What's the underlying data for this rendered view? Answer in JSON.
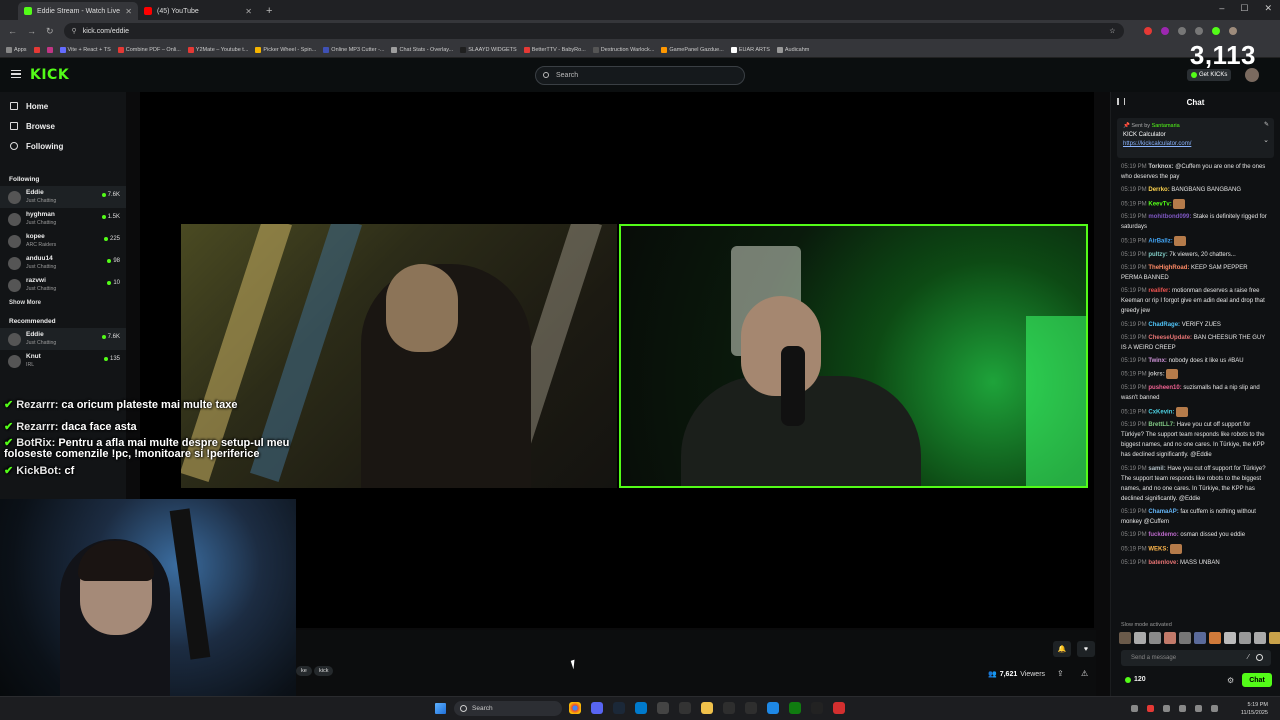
{
  "browser": {
    "tabs": [
      {
        "title": "Eddie Stream - Watch Live",
        "favicon_color": "#53fc18",
        "active": true
      },
      {
        "title": "(45) YouTube",
        "favicon_color": "#ff0000",
        "active": false
      }
    ],
    "new_tab": "+",
    "url": "kick.com/eddie",
    "window_controls": [
      "–",
      "☐",
      "✕"
    ],
    "bookmarks": [
      {
        "label": "Apps",
        "color": "#888888"
      },
      {
        "label": "",
        "color": "#e53935"
      },
      {
        "label": "",
        "color": "#c13584"
      },
      {
        "label": "Vite + React + TS",
        "color": "#646cff"
      },
      {
        "label": "Combine PDF – Onli...",
        "color": "#e53935"
      },
      {
        "label": "Y2Mate – Youtube t...",
        "color": "#e53935"
      },
      {
        "label": "Picker Wheel - Spin...",
        "color": "#f5b400"
      },
      {
        "label": "Online MP3 Cutter -...",
        "color": "#3f51b5"
      },
      {
        "label": "Chat Stats - Overlay...",
        "color": "#9e9e9e"
      },
      {
        "label": "SLAAYD WIDGETS",
        "color": "#1f1f1f"
      },
      {
        "label": "BetterTTV - BabyRo...",
        "color": "#e53935"
      },
      {
        "label": "Destruction Warlock...",
        "color": "#555555"
      },
      {
        "label": "GamePanel Gazdue...",
        "color": "#ff9800"
      },
      {
        "label": "EUAR ARTS",
        "color": "#ffffff"
      },
      {
        "label": "Audicahm",
        "color": "#999999"
      }
    ]
  },
  "kick": {
    "logo": "KICK",
    "search_placeholder": "Search",
    "get_kicks": "Get KICKs",
    "stream_overlay_viewers": "3,113",
    "accent": "#53fc18"
  },
  "sidebar": {
    "nav": [
      {
        "label": "Home",
        "icon": "home-icon"
      },
      {
        "label": "Browse",
        "icon": "browse-icon"
      },
      {
        "label": "Following",
        "icon": "heart-icon"
      }
    ],
    "following_title": "Following",
    "following": [
      {
        "name": "Eddie",
        "category": "Just Chatting",
        "viewers": "7.6K",
        "active": true
      },
      {
        "name": "hyghman",
        "category": "Just Chatting",
        "viewers": "1.5K"
      },
      {
        "name": "kopee",
        "category": "ARC Raiders",
        "viewers": "225"
      },
      {
        "name": "anduu14",
        "category": "Just Chatting",
        "viewers": "98"
      },
      {
        "name": "razvwi",
        "category": "Just Chatting",
        "viewers": "10"
      }
    ],
    "show_more": "Show More",
    "recommended_title": "Recommended",
    "recommended": [
      {
        "name": "Eddie",
        "category": "Just Chatting",
        "viewers": "7.6K",
        "active": true
      },
      {
        "name": "Knut",
        "category": "IRL",
        "viewers": "135"
      }
    ]
  },
  "overlay_chat": [
    {
      "user": "Rezarrr:",
      "text": "ca oricum plateste mai multe taxe"
    },
    {
      "user": "Rezarrr:",
      "text": "daca face asta"
    },
    {
      "user": "BotRix:",
      "text": "Pentru a afla mai multe despre setup-ul meu"
    },
    {
      "user": "",
      "text": "foloseste comenzile !pc, !monitoare si !periferice"
    },
    {
      "user": "KickBot:",
      "text": "cf"
    }
  ],
  "player": {
    "tags": [
      "ke",
      "kick"
    ],
    "viewers": "7,621",
    "viewers_label": "Viewers"
  },
  "chat": {
    "title": "Chat",
    "pinned": {
      "sent_by_prefix": "Sent by",
      "sent_by_user": "Santamaria",
      "title": "KICK Calculator",
      "link": "https://kickcalculator.com/"
    },
    "messages": [
      {
        "time": "05:19 PM",
        "user": "Torknox:",
        "color": "#cccccc",
        "text": "@Cuffem you are one of the ones who deserves the pay"
      },
      {
        "time": "05:19 PM",
        "user": "Derrko:",
        "color": "#ffd54f",
        "text": "BANGBANG BANGBANG"
      },
      {
        "time": "05:19 PM",
        "user": "KeevTv:",
        "color": "#53fc18",
        "text": ""
      },
      {
        "time": "05:19 PM",
        "user": "mohitbond099:",
        "color": "#7e57c2",
        "text": "Stake is definitely rigged for saturdays"
      },
      {
        "time": "05:19 PM",
        "user": "AirBallz:",
        "color": "#42a5f5",
        "text": ""
      },
      {
        "time": "05:19 PM",
        "user": "pultzy:",
        "color": "#80cbc4",
        "text": "7k viewers, 20 chatters..."
      },
      {
        "time": "05:19 PM",
        "user": "TheHighRoad:",
        "color": "#ff8a65",
        "text": "KEEP SAM PEPPER PERMA BANNED"
      },
      {
        "time": "05:19 PM",
        "user": "realifer:",
        "color": "#ef5350",
        "text": "motionman deserves a raise free Keeman or rip I forgot give em adin deal and drop that greedy jew"
      },
      {
        "time": "05:19 PM",
        "user": "ChadRage:",
        "color": "#4fc3f7",
        "text": "VERIFY ZUES"
      },
      {
        "time": "05:19 PM",
        "user": "CheeseUpdate:",
        "color": "#e57373",
        "text": "BAN CHEESUR THE GUY IS A WEIRD CREEP"
      },
      {
        "time": "05:19 PM",
        "user": "Twinx:",
        "color": "#ce93d8",
        "text": "nobody does it like us #BAU"
      },
      {
        "time": "05:19 PM",
        "user": "jokrs:",
        "color": "#bdbdbd",
        "text": ""
      },
      {
        "time": "05:19 PM",
        "user": "pusheen10:",
        "color": "#f06292",
        "text": "suzismalls had a nip slip and wasn't banned"
      },
      {
        "time": "05:19 PM",
        "user": "CxKevin:",
        "color": "#4dd0e1",
        "text": ""
      },
      {
        "time": "05:19 PM",
        "user": "BrettLL7:",
        "color": "#81c784",
        "text": "Have you cut off support for Türkiye? The support team responds like robots to the biggest names, and no one cares. In Türkiye, the KPP has declined significantly. @Eddie"
      },
      {
        "time": "05:19 PM",
        "user": "samil:",
        "color": "#b0bec5",
        "text": "Have you cut off support for Türkiye? The support team responds like robots to the biggest names, and no one cares. In Türkiye, the KPP has declined significantly. @Eddie"
      },
      {
        "time": "05:19 PM",
        "user": "ChamaAP:",
        "color": "#64b5f6",
        "text": "fax cuffem is nothing without monkey @Cuffem"
      },
      {
        "time": "05:19 PM",
        "user": "fuckdemo:",
        "color": "#ba68c8",
        "text": "osman dissed you eddie"
      },
      {
        "time": "05:19 PM",
        "user": "WEKS:",
        "color": "#ffb74d",
        "text": ""
      },
      {
        "time": "05:19 PM",
        "user": "batenlove:",
        "color": "#e57373",
        "text": "MASS UNBAN"
      }
    ],
    "slow_mode": "Slow mode activated",
    "send_placeholder": "Send a message",
    "points": "120",
    "chat_button": "Chat"
  },
  "taskbar": {
    "search": "Search",
    "time": "5:19 PM",
    "date": "11/15/2025"
  }
}
